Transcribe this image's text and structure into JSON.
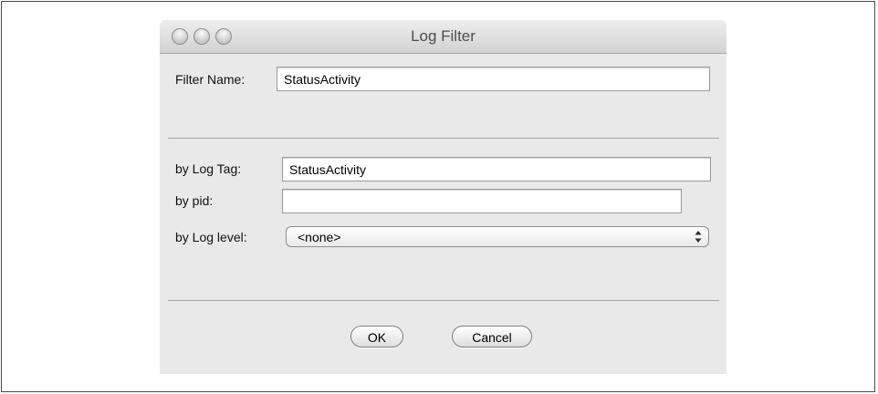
{
  "window": {
    "title": "Log Filter"
  },
  "filter_name": {
    "label": "Filter Name:",
    "value": "StatusActivity"
  },
  "log_tag": {
    "label": "by Log Tag:",
    "value": "StatusActivity"
  },
  "pid": {
    "label": "by pid:",
    "value": ""
  },
  "log_level": {
    "label": "by Log level:",
    "selected": "<none>"
  },
  "buttons": {
    "ok": "OK",
    "cancel": "Cancel"
  },
  "icons": {
    "window_controls": [
      "close-button",
      "minimize-button",
      "zoom-button"
    ],
    "select_arrows": "up-down-arrows-icon"
  }
}
